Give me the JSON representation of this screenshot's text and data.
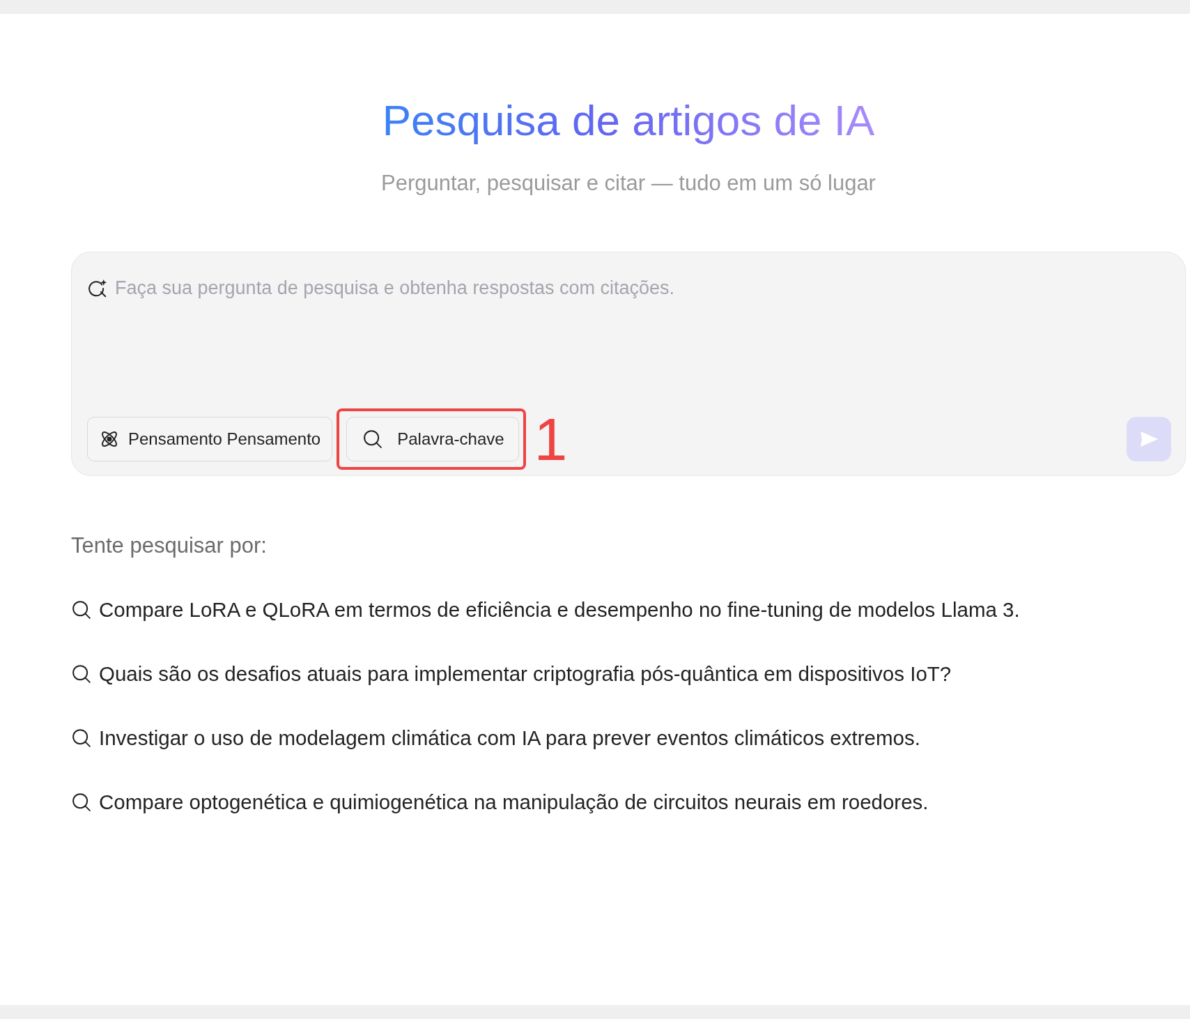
{
  "header": {
    "title": "Pesquisa de artigos de IA",
    "subtitle": "Perguntar, pesquisar e citar — tudo em um só lugar"
  },
  "search": {
    "placeholder": "Faça sua pergunta de pesquisa e obtenha respostas com citações.",
    "send_disabled": true
  },
  "tools": [
    {
      "kind": "thinking",
      "label": "Pensamento Pensamento"
    },
    {
      "kind": "keyword",
      "label": "Palavra-chave",
      "annotation": "1"
    }
  ],
  "suggestions": {
    "heading": "Tente pesquisar por:",
    "items": [
      "Compare LoRA e QLoRA em termos de eficiência e desempenho no fine-tuning de modelos Llama 3.",
      "Quais são os desafios atuais para implementar criptografia pós-quântica em dispositivos IoT?",
      "Investigar o uso de modelagem climática com IA para prever eventos climáticos extremos.",
      "Compare optogenética e quimiogenética na manipulação de circuitos neurais em roedores."
    ]
  }
}
